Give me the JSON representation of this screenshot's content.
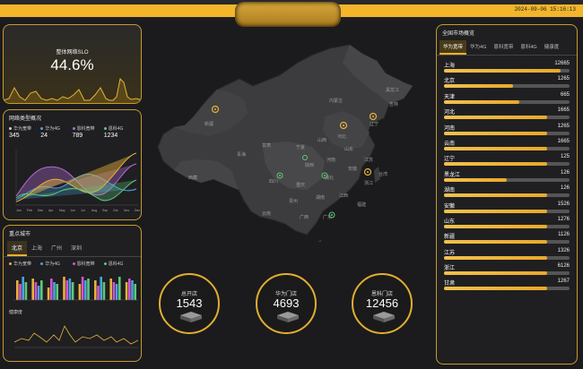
{
  "header": {
    "datetime": "2024-09-06 15:16:13"
  },
  "slo": {
    "label": "整体网络SLO",
    "value": "44.6%"
  },
  "network": {
    "title": "网络类型概况",
    "legend": [
      {
        "name": "华为宽带",
        "value": "345",
        "color": "#d0d0d0"
      },
      {
        "name": "华为4G",
        "value": "24",
        "color": "#4aa3e0"
      },
      {
        "name": "恩科宽带",
        "value": "789",
        "color": "#b46ad6"
      },
      {
        "name": "恩科4G",
        "value": "1234",
        "color": "#5ec87a"
      }
    ],
    "months": [
      "Jan",
      "Feb",
      "Mar",
      "Apr",
      "May",
      "Jun",
      "Jul",
      "Aug",
      "Sep",
      "Oct",
      "Nov",
      "Dec"
    ]
  },
  "cities": {
    "title": "重点城市",
    "tabs": [
      "北京",
      "上海",
      "广州",
      "深圳"
    ],
    "legend": [
      "华为宽带",
      "华为4G",
      "恩科宽带",
      "恩科4G"
    ],
    "trend_label": "健康度"
  },
  "counters": [
    {
      "label": "总开店",
      "value": "1543"
    },
    {
      "label": "华为门店",
      "value": "4693"
    },
    {
      "label": "恩科门店",
      "value": "12456"
    }
  ],
  "market": {
    "title": "全国市场概览",
    "tabs": [
      "华为宽带",
      "华为4G",
      "恩科宽带",
      "恩科4G",
      "健康度"
    ],
    "rows": [
      {
        "name": "上海",
        "value": "12665",
        "pct": 0.93
      },
      {
        "name": "北京",
        "value": "1265",
        "pct": 0.55
      },
      {
        "name": "天津",
        "value": "665",
        "pct": 0.6
      },
      {
        "name": "河北",
        "value": "1665",
        "pct": 0.82
      },
      {
        "name": "河南",
        "value": "1265",
        "pct": 0.82
      },
      {
        "name": "云南",
        "value": "1665",
        "pct": 0.82
      },
      {
        "name": "辽宁",
        "value": "125",
        "pct": 0.82
      },
      {
        "name": "黑龙江",
        "value": "126",
        "pct": 0.5
      },
      {
        "name": "湖南",
        "value": "126",
        "pct": 0.82
      },
      {
        "name": "安徽",
        "value": "1526",
        "pct": 0.82
      },
      {
        "name": "山东",
        "value": "1276",
        "pct": 0.82
      },
      {
        "name": "新疆",
        "value": "1126",
        "pct": 0.82
      },
      {
        "name": "江苏",
        "value": "1326",
        "pct": 0.82
      },
      {
        "name": "浙江",
        "value": "6126",
        "pct": 0.82
      },
      {
        "name": "甘肃",
        "value": "1267",
        "pct": 0.82
      }
    ]
  },
  "map": {
    "labels": [
      "黑龙江",
      "吉林",
      "辽宁",
      "内蒙古",
      "新疆",
      "西藏",
      "青海",
      "甘肃",
      "宁夏",
      "陕西",
      "山西",
      "河北",
      "山东",
      "河南",
      "安徽",
      "江苏",
      "湖北",
      "四川",
      "重庆",
      "贵州",
      "云南",
      "湖南",
      "江西",
      "浙江",
      "福建",
      "广东",
      "广西",
      "台湾"
    ]
  }
}
